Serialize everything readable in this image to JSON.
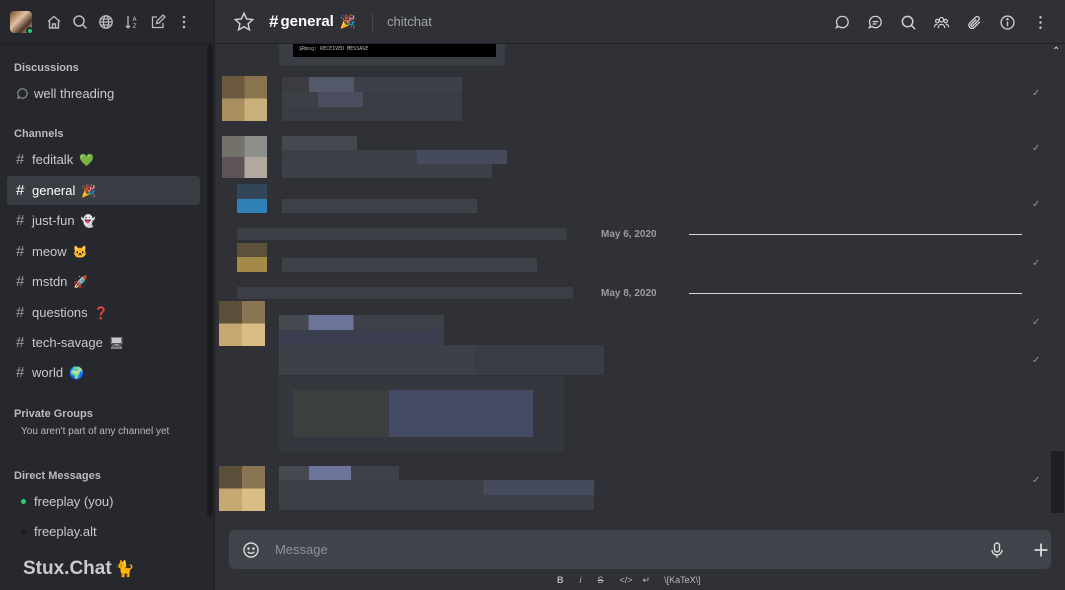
{
  "sidebar": {
    "sections": {
      "discussions": "Discussions",
      "channels": "Channels",
      "private_groups": "Private Groups",
      "direct_messages": "Direct Messages"
    },
    "discussion_items": [
      {
        "label": "well threading"
      }
    ],
    "channels": [
      {
        "label": "feditalk",
        "emoji": "💚"
      },
      {
        "label": "general",
        "emoji": "🎉",
        "active": true
      },
      {
        "label": "just-fun",
        "emoji": "👻"
      },
      {
        "label": "meow",
        "emoji": "🐱"
      },
      {
        "label": "mstdn",
        "emoji": "🚀"
      },
      {
        "label": "questions",
        "emoji": "❓"
      },
      {
        "label": "tech-savage",
        "emoji": "🖥"
      },
      {
        "label": "world",
        "emoji": "🌍"
      }
    ],
    "private_groups_note": "You aren't part of any channel yet",
    "direct_messages": [
      {
        "label": "freeplay (you)",
        "status_color": "#2ecc71"
      },
      {
        "label": "freeplay.alt",
        "status_color": "#1e1f22"
      }
    ],
    "brand": "Stux.Chat",
    "brand_icon": "🐈"
  },
  "header": {
    "title": "general",
    "title_emoji": "🎉",
    "topic": "chitchat",
    "actions": [
      "threads-icon",
      "discussion-icon",
      "search-icon",
      "members-icon",
      "files-icon",
      "info-icon",
      "kebab-icon"
    ]
  },
  "messages": {
    "console_text": "$Rmsg: RECEIVED MESSAGE",
    "dates": [
      "May 6, 2020",
      "May 8, 2020"
    ],
    "read_mark": "✓"
  },
  "composer": {
    "placeholder": "Message",
    "format": [
      "B",
      "i",
      "S",
      "</>",
      "↵",
      "\\[KaTeX\\]"
    ]
  },
  "colors": {
    "accent_online": "#2ecc71",
    "background": "#2f3136",
    "sidebar": "#26282d"
  }
}
